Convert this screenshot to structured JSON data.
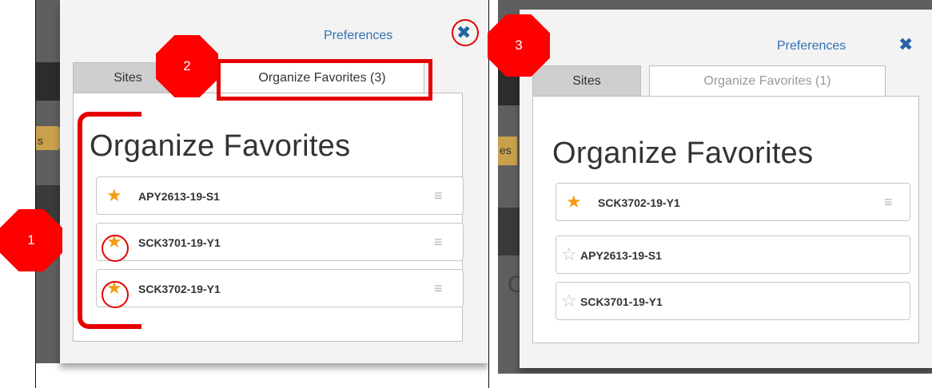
{
  "left": {
    "preferences_link": "Preferences",
    "close_icon": "close-icon",
    "tabs": [
      {
        "label": "Sites",
        "active": false
      },
      {
        "label": "Organize Favorites (3)",
        "active": true
      }
    ],
    "heading": "Organize Favorites",
    "background_peek": "s",
    "favorites": [
      {
        "code": "APY2613-19-S1",
        "starred": true
      },
      {
        "code": "SCK3701-19-Y1",
        "starred": true
      },
      {
        "code": "SCK3702-19-Y1",
        "starred": true
      }
    ]
  },
  "right": {
    "preferences_link": "Preferences",
    "close_icon": "close-icon",
    "tabs": [
      {
        "label": "Sites",
        "active": false
      },
      {
        "label": "Organize Favorites (1)",
        "active": true
      }
    ],
    "heading": "Organize Favorites",
    "background_peek": "es",
    "background_peek_2": "C",
    "favorites": [
      {
        "code": "SCK3702-19-Y1",
        "starred": true
      },
      {
        "code": "APY2613-19-S1",
        "starred": false
      },
      {
        "code": "SCK3701-19-Y1",
        "starred": false
      }
    ]
  },
  "annotations": {
    "badge_1": "1",
    "badge_2": "2",
    "badge_3": "3",
    "color": "#ff0000"
  },
  "colors": {
    "star_filled": "#f39c12",
    "star_empty": "#bfbfbf",
    "link": "#2f72b5"
  },
  "icons": {
    "filled_star": "★",
    "empty_star": "☆",
    "drag_handle": "≡",
    "close": "✖"
  }
}
